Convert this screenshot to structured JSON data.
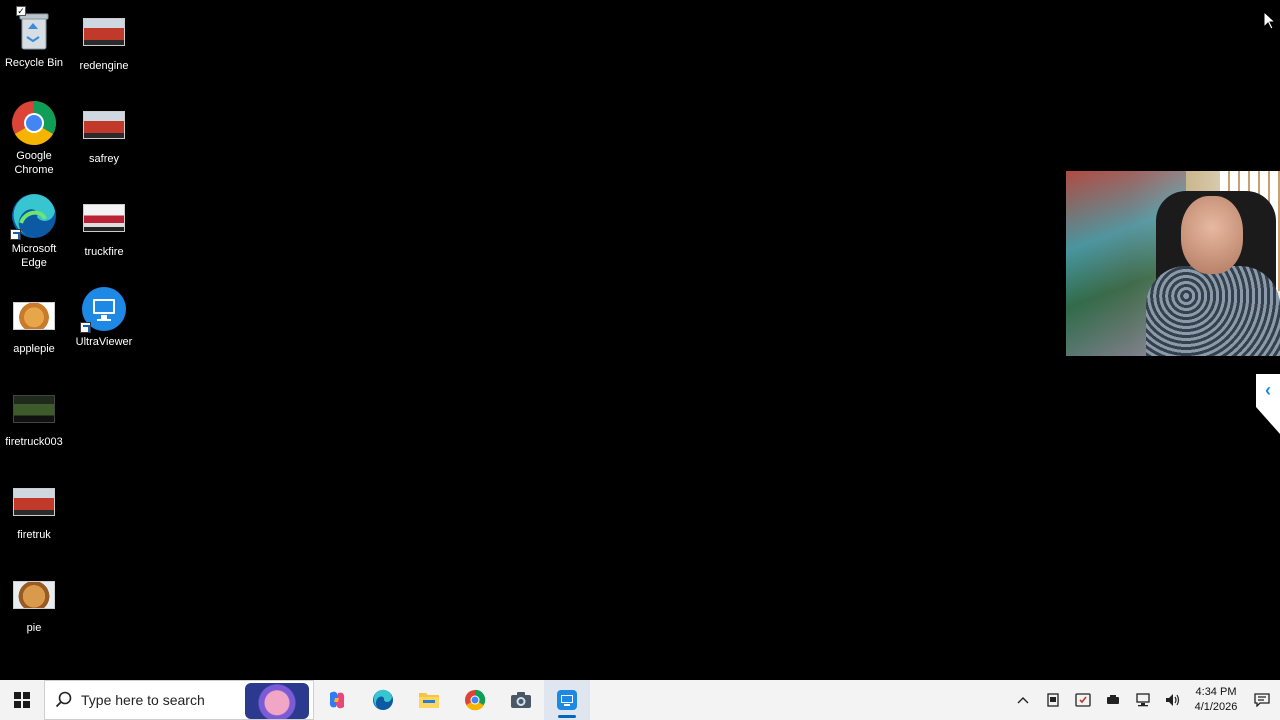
{
  "desktop_icons": [
    {
      "id": "recycle-bin",
      "label": "Recycle Bin",
      "icon": "recycle-bin-icon"
    },
    {
      "id": "redengine",
      "label": "redengine",
      "icon": "image-thumbnail-icon"
    },
    {
      "id": "google-chrome",
      "label": "Google Chrome",
      "icon": "chrome-icon"
    },
    {
      "id": "safrey",
      "label": "safrey",
      "icon": "image-thumbnail-icon"
    },
    {
      "id": "microsoft-edge",
      "label": "Microsoft Edge",
      "icon": "edge-icon"
    },
    {
      "id": "truckfire",
      "label": "truckfire",
      "icon": "image-thumbnail-icon"
    },
    {
      "id": "applepie",
      "label": "applepie",
      "icon": "image-thumbnail-icon"
    },
    {
      "id": "ultraviewer",
      "label": "UltraViewer",
      "icon": "ultraviewer-icon"
    },
    {
      "id": "firetruck003",
      "label": "firetruck003",
      "icon": "image-thumbnail-icon"
    },
    {
      "id": "firetruk",
      "label": "firetruk",
      "icon": "image-thumbnail-icon"
    },
    {
      "id": "pie",
      "label": "pie",
      "icon": "image-thumbnail-icon"
    }
  ],
  "taskbar": {
    "search_placeholder": "Type here to search",
    "pinned": [
      {
        "name": "copilot",
        "icon": "copilot-icon"
      },
      {
        "name": "edge",
        "icon": "edge-icon"
      },
      {
        "name": "file-explorer",
        "icon": "folder-icon"
      },
      {
        "name": "chrome",
        "icon": "chrome-icon"
      },
      {
        "name": "camera",
        "icon": "camera-icon"
      },
      {
        "name": "ultraviewer",
        "icon": "ultraviewer-icon",
        "active": true
      }
    ],
    "clock": {
      "time": "4:34 PM",
      "date": "4/1/2026"
    }
  },
  "colors": {
    "desktop_bg": "#000000",
    "taskbar_bg": "#f3f3f3",
    "accent": "#0067c0"
  }
}
